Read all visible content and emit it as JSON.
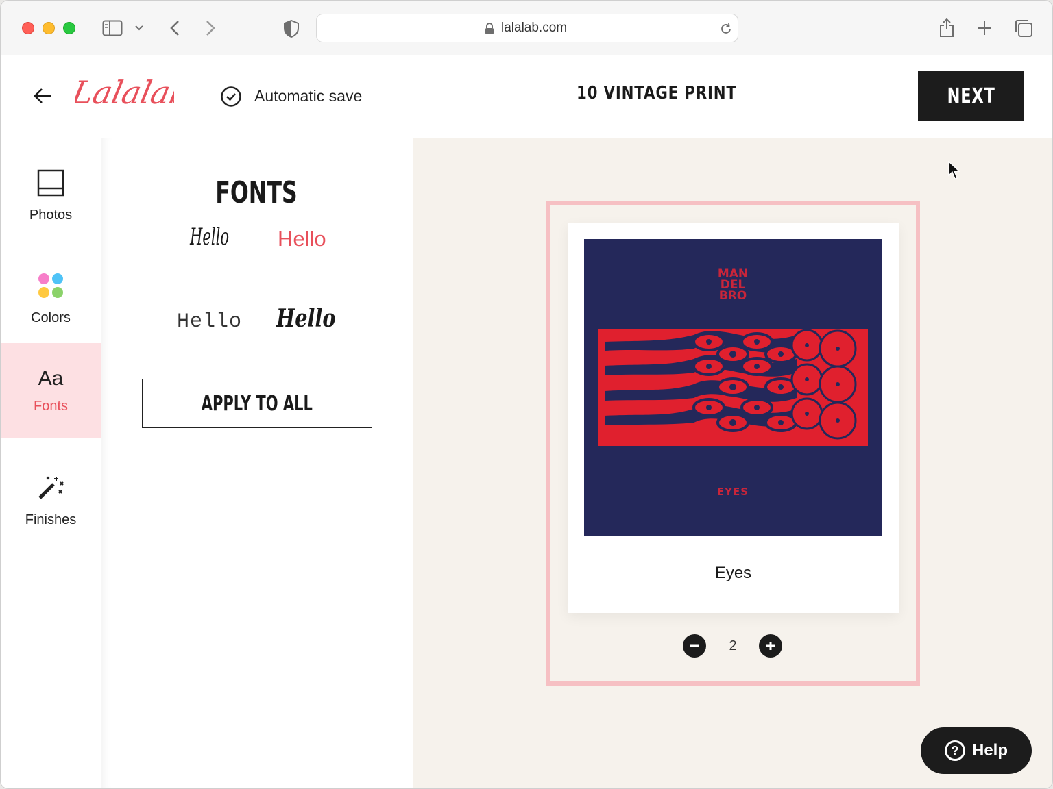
{
  "browser": {
    "url": "lalalab.com",
    "icons": [
      "sidebar-icon",
      "chevron-down-icon",
      "back-icon",
      "forward-icon",
      "shield-icon",
      "lock-icon",
      "reload-icon",
      "share-icon",
      "plus-icon",
      "tabs-icon"
    ]
  },
  "header": {
    "logo_text": "Lalalab.",
    "autosave_label": "Automatic save",
    "product_title": "10 VINTAGE PRINT",
    "next_label": "NEXT"
  },
  "sidebar": {
    "items": [
      {
        "label": "Photos",
        "icon": "photo-frame-icon"
      },
      {
        "label": "Colors",
        "icon": "color-dots-icon"
      },
      {
        "label": "Fonts",
        "icon": "Aa",
        "active": true
      },
      {
        "label": "Finishes",
        "icon": "magic-wand-icon"
      }
    ]
  },
  "panel": {
    "title": "FONTS",
    "font_options": [
      "Hello",
      "Hello",
      "Hello",
      "Hello"
    ],
    "apply_all_label": "APPLY TO ALL"
  },
  "print": {
    "artwork_text": "MAN DEL BRO",
    "artwork_title": "EYES",
    "caption": "Eyes",
    "quantity": "2"
  },
  "help_label": "Help",
  "colors": {
    "accent_pink": "#e8505b",
    "active_bg": "#fde0e3",
    "selection_border": "#f6c0c3",
    "canvas_bg": "#f6f2ec",
    "art_blue": "#24285a",
    "art_red": "#e0202e"
  }
}
